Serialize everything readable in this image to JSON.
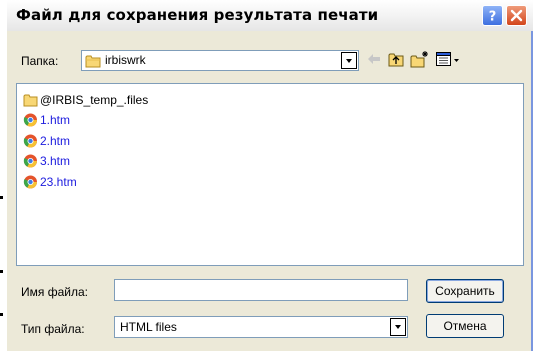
{
  "window": {
    "title": "Файл для сохранения результата печати",
    "help_icon": "help-icon",
    "close_icon": "close-icon"
  },
  "folder_bar": {
    "label": "Папка:",
    "current_folder": "irbiswrk",
    "toolbar_icons": [
      "back-arrow-icon",
      "up-folder-icon",
      "new-folder-icon",
      "view-menu-icon"
    ]
  },
  "file_list": [
    {
      "name": "@IRBIS_temp_.files",
      "icon": "folder-icon",
      "type": "folder"
    },
    {
      "name": "1.htm",
      "icon": "chrome-icon",
      "type": "file"
    },
    {
      "name": "2.htm",
      "icon": "chrome-icon",
      "type": "file"
    },
    {
      "name": "3.htm",
      "icon": "chrome-icon",
      "type": "file"
    },
    {
      "name": "23.htm",
      "icon": "chrome-icon",
      "type": "file"
    }
  ],
  "filename": {
    "label": "Имя файла:",
    "value": ""
  },
  "filetype": {
    "label": "Тип файла:",
    "selected": "HTML files"
  },
  "buttons": {
    "save": "Сохранить",
    "cancel": "Отмена"
  },
  "colors": {
    "dialog_bg": "#ece9d8",
    "field_border": "#7f9db9",
    "file_link": "#1d1cde",
    "close_button": "#d3451b",
    "help_button": "#3d6fe0"
  }
}
